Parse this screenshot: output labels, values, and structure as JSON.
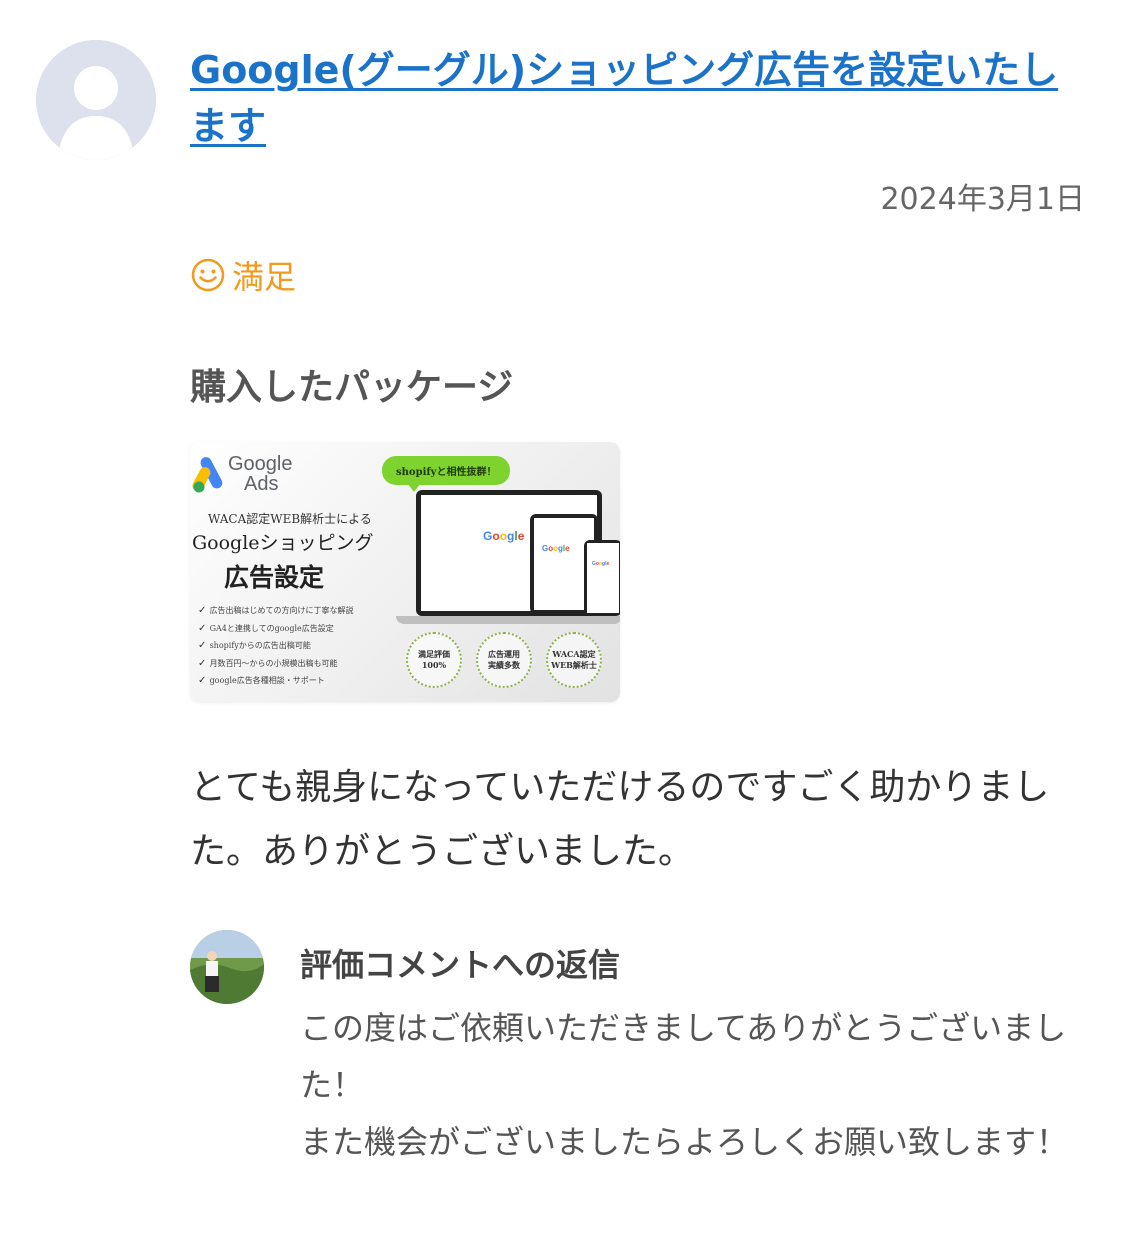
{
  "review": {
    "title": "Google(グーグル)ショッピング広告を設定いたします",
    "date": "2024年3月1日",
    "rating_label": "満足",
    "package_heading": "購入したパッケージ",
    "body": "とても親身になっていただけるのですごく助かりました。ありがとうございました。"
  },
  "package_image": {
    "logo_line1": "Google",
    "logo_line2": "Ads",
    "subtitle": "WACA認定WEB解析士による",
    "title_line1": "Googleショッピング",
    "title_line2": "広告設定",
    "bubble": "shopifyと相性抜群！",
    "checks": [
      "広告出稿はじめての方向けに丁寧な解説",
      "GA4と連携してのgoogle広告設定",
      "shopifyからの広告出稿可能",
      "月数百円〜からの小規模出稿も可能",
      "google広告各種相談・サポート"
    ],
    "badges": [
      {
        "line1": "満足評価",
        "line2": "100%"
      },
      {
        "line1": "広告運用",
        "line2": "実績多数"
      },
      {
        "line1": "WACA認定",
        "line2": "WEB解析士"
      }
    ],
    "screen_word": "Google"
  },
  "reply": {
    "title": "評価コメントへの返信",
    "line1": "この度はご依頼いただきましてありがとうございました！",
    "line2": "また機会がございましたらよろしくお願い致します！"
  },
  "colors": {
    "link": "#1a73c9",
    "rating": "#f39a1c",
    "date": "#666666"
  },
  "icons": {
    "reviewer_avatar": "default-user-silhouette",
    "rating": "smile-face-icon"
  }
}
